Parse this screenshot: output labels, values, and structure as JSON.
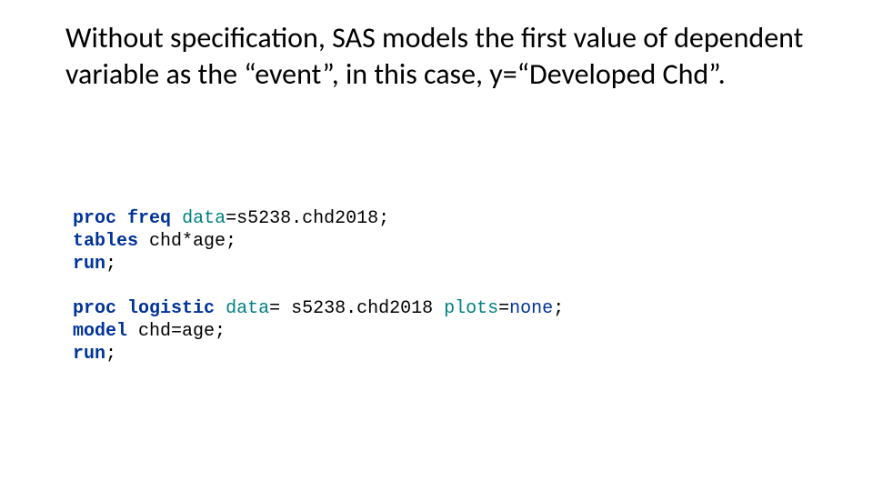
{
  "heading": "Without specification, SAS models the first value of dependent variable as the “event”, in this case, y=“Developed Chd”.",
  "code": {
    "block1": {
      "kw_proc": "proc",
      "kw_freq": "freq",
      "opt_data": "data",
      "eq": "=",
      "dataset": "s5238.chd2018",
      "semi": ";",
      "kw_tables": "tables",
      "tables_expr": "chd*age",
      "kw_run": "run"
    },
    "block2": {
      "kw_proc": "proc",
      "kw_logistic": "logistic",
      "opt_data": "data",
      "eq": "=",
      "dataset": " s5238.chd2018",
      "opt_plots": "plots",
      "val_none": "none",
      "semi": ";",
      "kw_model": "model",
      "model_expr": "chd=age",
      "kw_run": "run"
    }
  }
}
